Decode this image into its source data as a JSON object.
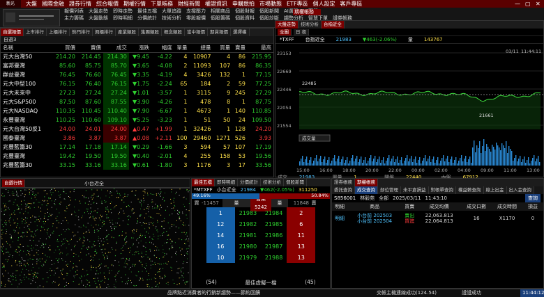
{
  "menu": {
    "logo": "新光TRADE",
    "items": [
      "大盤",
      "國際金融",
      "證券行情",
      "綜合報價",
      "期權行情",
      "下單帳務",
      "財經新聞",
      "權證資訊",
      "申購競拍",
      "市場動態",
      "ETF專區",
      "個人設定",
      "客戶專區"
    ],
    "controls": [
      "—",
      "▢",
      "✕"
    ]
  },
  "toolbar": {
    "row1": [
      "報價列表",
      "大盤走勢",
      "即時走勢",
      "最佳五檔",
      "大單追蹤",
      "支撐壓力",
      "相關商品",
      "個股財報",
      "個股新聞",
      "AI選股",
      "下單"
    ],
    "row2": [
      "主力籌碼",
      "大盤動態",
      "即時明細",
      "分價統計",
      "技術分析",
      "零股報價",
      "個股籌碼",
      "個股資料",
      "個股診斷",
      "趨勢分析",
      "智慧下單",
      "證券帳務"
    ],
    "right1": "期權帳務",
    "right2": "期權帳務"
  },
  "quote": {
    "tabs": [
      "自選報價",
      "上市排行",
      "上櫃排行",
      "熱門排行",
      "興櫃排行",
      "產業類股",
      "集團類股",
      "概念類股",
      "當中報價",
      "期貨報價",
      "選擇權",
      "選擇權"
    ],
    "group": "自選3",
    "tab_sel": "報價列表",
    "columns": [
      "名稱",
      "買價",
      "賣價",
      "成交",
      "漲跌",
      "幅度",
      "單量",
      "總量",
      "買量",
      "賣量",
      "最高"
    ],
    "rows": [
      {
        "name": "元大台灣50",
        "bid": "214.20",
        "ask": "214.45",
        "last": "214.30",
        "chg": "▼9.45",
        "pct": "-4.22",
        "vol": "4",
        "tot": "10907",
        "bq": "4",
        "aq": "86",
        "hi": "215.95",
        "dir": "d"
      },
      {
        "name": "富邦臺灣",
        "bid": "85.60",
        "ask": "85.75",
        "last": "85.70",
        "chg": "▼3.65",
        "pct": "-4.08",
        "vol": "2",
        "tot": "11093",
        "bq": "107",
        "aq": "86",
        "hi": "86.35",
        "dir": "d"
      },
      {
        "name": "群益臺灣",
        "bid": "76.45",
        "ask": "76.60",
        "last": "76.45",
        "chg": "▼3.35",
        "pct": "-4.19",
        "vol": "4",
        "tot": "3426",
        "bq": "132",
        "aq": "1",
        "hi": "77.15",
        "dir": "d"
      },
      {
        "name": "元大中型100",
        "bid": "76.15",
        "ask": "76.40",
        "last": "76.15",
        "chg": "▼1.75",
        "pct": "-2.24",
        "vol": "65",
        "tot": "184",
        "bq": "2",
        "aq": "59",
        "hi": "77.25",
        "dir": "d"
      },
      {
        "name": "元大未來中",
        "bid": "27.23",
        "ask": "27.24",
        "last": "27.24",
        "chg": "▼1.01",
        "pct": "-3.57",
        "vol": "1",
        "tot": "3115",
        "bq": "9",
        "aq": "245",
        "hi": "27.29",
        "dir": "d"
      },
      {
        "name": "元大S&P500",
        "bid": "87.50",
        "ask": "87.60",
        "last": "87.55",
        "chg": "▼3.90",
        "pct": "-4.26",
        "vol": "1",
        "tot": "478",
        "bq": "8",
        "aq": "1",
        "hi": "87.75",
        "dir": "d"
      },
      {
        "name": "元大NASDAQ",
        "bid": "110.35",
        "ask": "110.45",
        "last": "110.40",
        "chg": "▼7.90",
        "pct": "-6.67",
        "vol": "1",
        "tot": "4673",
        "bq": "1",
        "aq": "140",
        "hi": "110.85",
        "dir": "d"
      },
      {
        "name": "永豐臺灣",
        "bid": "110.25",
        "ask": "110.60",
        "last": "109.10",
        "chg": "▼5.25",
        "pct": "-3.23",
        "vol": "1",
        "tot": "51",
        "bq": "50",
        "aq": "24",
        "hi": "109.50",
        "dir": "d"
      },
      {
        "name": "元大台灣50反1",
        "bid": "24.00",
        "ask": "24.01",
        "last": "24.00",
        "chg": "▲0.47",
        "pct": "+1.99",
        "vol": "1",
        "tot": "32426",
        "bq": "1",
        "aq": "128",
        "hi": "24.20",
        "dir": "u"
      },
      {
        "name": "國泰臺灣",
        "bid": "3.86",
        "ask": "3.87",
        "last": "3.87",
        "chg": "▲0.08",
        "pct": "+2.11",
        "vol": "100",
        "tot": "29460",
        "bq": "1271",
        "aq": "526",
        "hi": "3.93",
        "dir": "u"
      },
      {
        "name": "兆豐藍籌30",
        "bid": "17.14",
        "ask": "17.18",
        "last": "17.14",
        "chg": "▼0.29",
        "pct": "-1.66",
        "vol": "3",
        "tot": "594",
        "bq": "57",
        "aq": "107",
        "hi": "17.19",
        "dir": "d"
      },
      {
        "name": "兆豐臺灣",
        "bid": "19.42",
        "ask": "19.50",
        "last": "19.50",
        "chg": "▼0.40",
        "pct": "-2.01",
        "vol": "4",
        "tot": "255",
        "bq": "158",
        "aq": "53",
        "hi": "19.56",
        "dir": "d"
      },
      {
        "name": "兆豐藍籌30",
        "bid": "33.15",
        "ask": "33.16",
        "last": "33.16",
        "chg": "▼0.61",
        "pct": "-1.80",
        "vol": "3",
        "tot": "1176",
        "bq": "3",
        "aq": "17",
        "hi": "33.56",
        "dir": "d"
      }
    ]
  },
  "chart": {
    "tabs": [
      "大盤走勢",
      "技術分析",
      "台指近全"
    ],
    "subtabs": [
      "全圖",
      "日 夜"
    ],
    "search_placeholder": "請輸入商品代碼或名稱",
    "symbol": "*TXFF",
    "name": "台指近全",
    "price": "21983",
    "change": "▼463(-2.06%)",
    "volume_label": "量",
    "volume": "143767",
    "date": "03/11",
    "time": "11:44:11",
    "period": "當日",
    "high_label": "22485",
    "low_label": "21661",
    "yticks": [
      "23153",
      "22669",
      "22446",
      "22054",
      "21554"
    ],
    "xticks": [
      "15:00",
      "16:00",
      "18:00",
      "20:00",
      "22:00",
      "00:00",
      "02:00",
      "04:00",
      "09:00",
      "11:00",
      "13:00"
    ],
    "vol_label": "成交量",
    "stats": [
      [
        "成交",
        "21983",
        "單量",
        "1",
        "開盤",
        "22440",
        "內盤",
        "67912"
      ],
      [
        "漲跌",
        "▼463",
        "買出",
        "21982",
        "總量",
        "143767",
        "最低",
        "21661",
        "外盤",
        "75855"
      ],
      [
        "幅度",
        "-2.06%",
        "賣價",
        "74605",
        "振幅",
        "3.67%",
        "最高",
        "22485",
        "差額",
        "7943"
      ]
    ]
  },
  "bottom_left": {
    "tabs": [
      "自選行情"
    ],
    "title": "小台近全"
  },
  "book": {
    "tabs": [
      "最佳五檔",
      "即時明細",
      "分價統計",
      "技術分析",
      "個股新聞",
      "個股新聞"
    ],
    "symbol": "*MTXFF",
    "name": "小台近全",
    "price": "21984",
    "change": "▼462(-2.05%)",
    "volume": "311250",
    "buy_pct": "49.16%",
    "sell_pct": "50.84%",
    "head": [
      "買",
      "-11457",
      "量",
      "價",
      "量",
      "11848",
      "賣"
    ],
    "mid_label": "營業 5242",
    "mid_right": "5482",
    "rows": [
      [
        "1",
        "21983",
        "21984",
        "2"
      ],
      [
        "12",
        "21982",
        "21985",
        "6"
      ],
      [
        "14",
        "21981",
        "21986",
        "11"
      ],
      [
        "16",
        "21980",
        "21987",
        "13"
      ],
      [
        "10",
        "21979",
        "21988",
        "13"
      ]
    ],
    "foot_left": "(54)",
    "foot_mid": "最佳虛擬一檔",
    "foot_right": "(45)"
  },
  "orders": {
    "tabs": [
      "證券帳務",
      "期權帳務",
      "期權帳務"
    ],
    "subtabs": [
      "委託查詢",
      "成交查詢",
      "部位管理",
      "未平倉損益",
      "對帳單查詢",
      "權益數查詢",
      "線上出金",
      "出入金查詢"
    ],
    "account": "S856001",
    "acct_name": "林毅苑",
    "filter": "全部",
    "date": "2025/03/11",
    "time": "11:43:10",
    "query": "查詢",
    "columns": [
      "明細",
      "商品",
      "買賣",
      "成交均價",
      "成交口數",
      "成交時間",
      "",
      "損益"
    ],
    "rows": [
      {
        "detail": "明細",
        "item1": "小台前 202503",
        "item2": "小台前 202504",
        "side1": "賣出",
        "side2": "買進",
        "price1": "22,063.813",
        "price2": "22,064.813",
        "qty": "16",
        "time": "X1170",
        "pl": "0"
      }
    ]
  },
  "status": {
    "center": "品牌點近消費者的行銷新趨勢——節約回饋",
    "right1": "交帳主機連線成功(124.54)",
    "right2": "證證成功",
    "clock": "11:44:12"
  }
}
